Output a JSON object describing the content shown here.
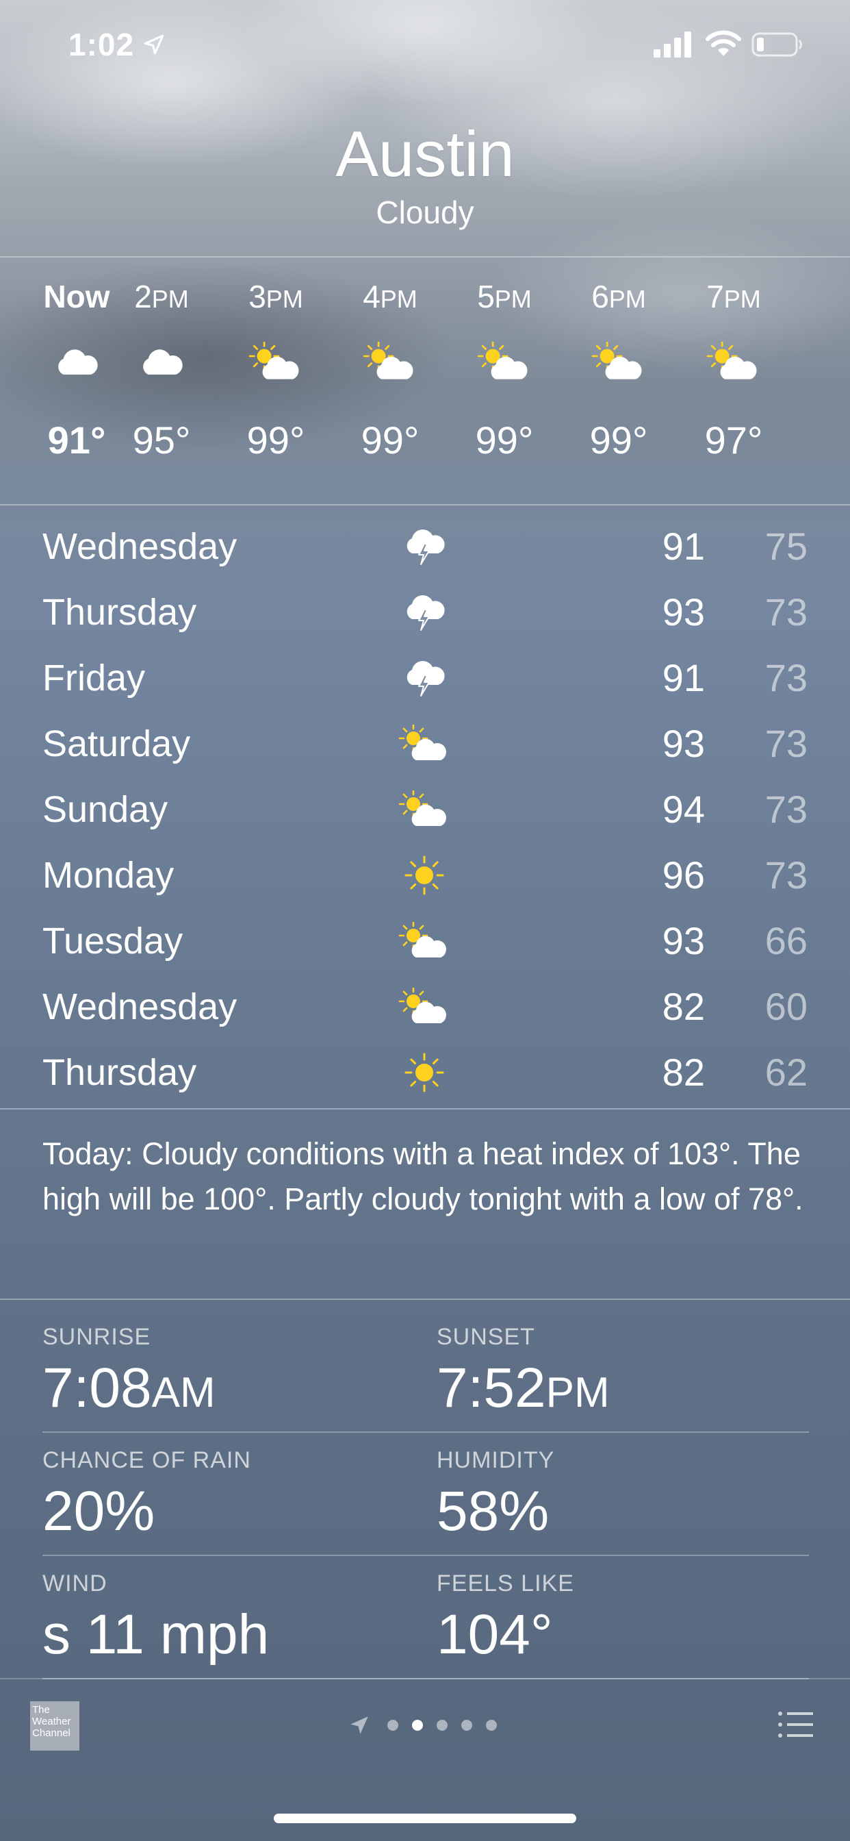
{
  "status_bar": {
    "time": "1:02"
  },
  "location": {
    "city": "Austin",
    "condition": "Cloudy"
  },
  "hourly": [
    {
      "label": "Now",
      "ampm": "",
      "icon": "cloud-icon",
      "temp": "91°",
      "bold": true
    },
    {
      "label": "2",
      "ampm": "PM",
      "icon": "cloud-icon",
      "temp": "95°"
    },
    {
      "label": "3",
      "ampm": "PM",
      "icon": "partly-sunny-icon",
      "temp": "99°"
    },
    {
      "label": "4",
      "ampm": "PM",
      "icon": "partly-sunny-icon",
      "temp": "99°"
    },
    {
      "label": "5",
      "ampm": "PM",
      "icon": "partly-sunny-icon",
      "temp": "99°"
    },
    {
      "label": "6",
      "ampm": "PM",
      "icon": "partly-sunny-icon",
      "temp": "99°"
    },
    {
      "label": "7",
      "ampm": "PM",
      "icon": "partly-sunny-icon",
      "temp": "97°"
    }
  ],
  "daily": [
    {
      "day": "Wednesday",
      "icon": "thunderstorm-icon",
      "high": "91",
      "low": "75"
    },
    {
      "day": "Thursday",
      "icon": "thunderstorm-icon",
      "high": "93",
      "low": "73"
    },
    {
      "day": "Friday",
      "icon": "thunderstorm-icon",
      "high": "91",
      "low": "73"
    },
    {
      "day": "Saturday",
      "icon": "partly-sunny-icon",
      "high": "93",
      "low": "73"
    },
    {
      "day": "Sunday",
      "icon": "partly-sunny-icon",
      "high": "94",
      "low": "73"
    },
    {
      "day": "Monday",
      "icon": "sun-icon",
      "high": "96",
      "low": "73"
    },
    {
      "day": "Tuesday",
      "icon": "partly-sunny-icon",
      "high": "93",
      "low": "66"
    },
    {
      "day": "Wednesday",
      "icon": "partly-sunny-icon",
      "high": "82",
      "low": "60"
    },
    {
      "day": "Thursday",
      "icon": "sun-icon",
      "high": "82",
      "low": "62"
    }
  ],
  "summary": "Today: Cloudy conditions with a heat index of 103°. The high will be 100°. Partly cloudy tonight with a low of 78°.",
  "details": {
    "sunrise_label": "SUNRISE",
    "sunrise_value": "7:08",
    "sunrise_unit": "AM",
    "sunset_label": "SUNSET",
    "sunset_value": "7:52",
    "sunset_unit": "PM",
    "rain_label": "CHANCE OF RAIN",
    "rain_value": "20%",
    "humidity_label": "HUMIDITY",
    "humidity_value": "58%",
    "wind_label": "WIND",
    "wind_value": "s 11 mph",
    "feels_label": "FEELS LIKE",
    "feels_value": "104°"
  },
  "footer": {
    "logo_text": "The Weather Channel",
    "page_count": 5,
    "active_page": 1
  },
  "colors": {
    "sun": "#ffd21f",
    "cloud": "#ffffff",
    "low_temp": "rgba(255,255,255,0.55)"
  }
}
